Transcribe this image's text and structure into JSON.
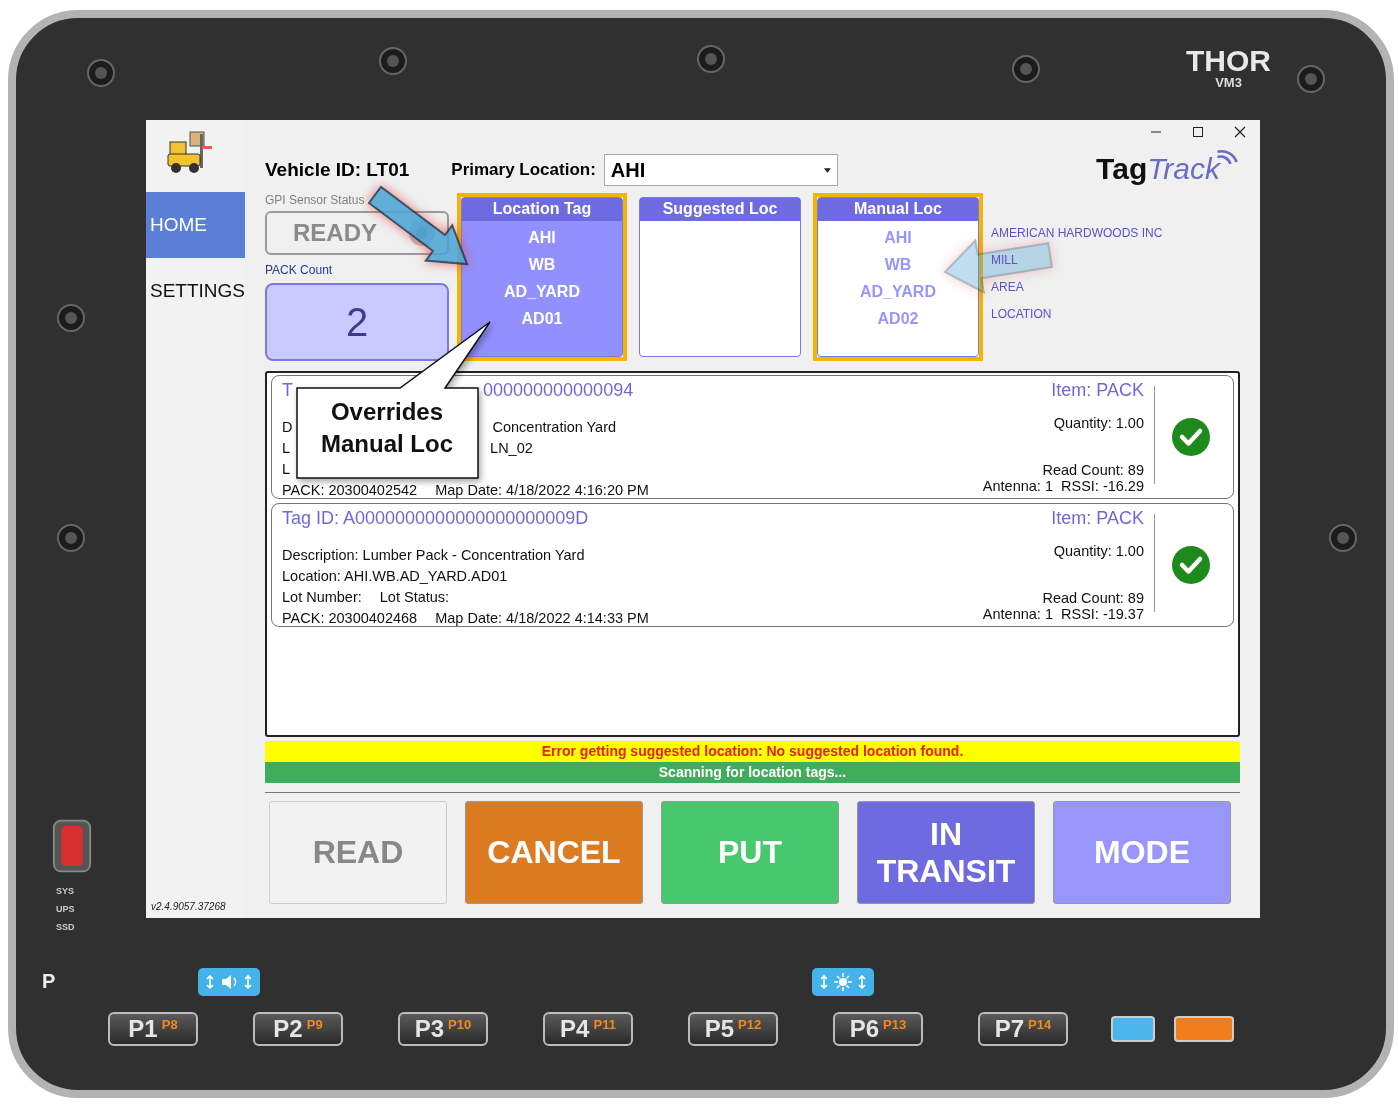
{
  "device": {
    "brand": "THOR",
    "model": "VM3",
    "power_label": "P",
    "indicators": [
      "SYS",
      "UPS",
      "SSD"
    ],
    "hint_icons": [
      {
        "kind": "volume"
      },
      {
        "kind": "brightness"
      }
    ],
    "keys": [
      {
        "label": "P1",
        "alt": "P8"
      },
      {
        "label": "P2",
        "alt": "P9"
      },
      {
        "label": "P3",
        "alt": "P10"
      },
      {
        "label": "P4",
        "alt": "P11"
      },
      {
        "label": "P5",
        "alt": "P12"
      },
      {
        "label": "P6",
        "alt": "P13"
      },
      {
        "label": "P7",
        "alt": "P14"
      }
    ]
  },
  "sidebar": {
    "items": [
      {
        "label": "HOME",
        "selected": true
      },
      {
        "label": "SETTINGS",
        "selected": false
      }
    ],
    "version": "v2.4.9057.37268"
  },
  "header": {
    "vehicle_id": "Vehicle ID: LT01",
    "primary_location_label": "Primary Location:",
    "primary_location": "AHI",
    "logo": {
      "part1": "Tag",
      "part2": "Track"
    }
  },
  "gpi": {
    "label": "GPI Sensor Status",
    "status": "READY",
    "disabled": true
  },
  "pack_count": {
    "label": "PACK Count",
    "value": "2"
  },
  "location_panels": [
    {
      "title": "Location Tag",
      "kind": "filled",
      "highlighted": true,
      "segments": [
        "AHI",
        "WB",
        "AD_YARD",
        "AD01"
      ]
    },
    {
      "title": "Suggested Loc",
      "kind": "plain",
      "highlighted": false
    },
    {
      "title": "Manual Loc",
      "kind": "plain",
      "highlighted": true,
      "segments": [
        "AHI",
        "WB",
        "AD_YARD",
        "AD02"
      ]
    }
  ],
  "legend": [
    "AMERICAN HARDWOODS INC",
    "MILL",
    "AREA",
    "LOCATION"
  ],
  "tags": [
    {
      "covered": true,
      "title": [
        "T",
        "000000000000094"
      ],
      "item": "Item: PACK",
      "lines": [
        [
          "D",
          "Concentration Yard"
        ],
        [
          "L",
          "LN_02"
        ],
        [
          "L"
        ]
      ],
      "pack": "PACK: 20300402542",
      "map_date": "Map Date: 4/18/2022 4:16:20 PM",
      "quantity": "Quantity: 1.00",
      "read_count": "Read Count: 89",
      "antenna": "Antenna: 1",
      "rssi": "RSSI: -16.29",
      "ok": true
    },
    {
      "covered": false,
      "title": [
        "Tag ID: A0000000000000000000009D"
      ],
      "item": "Item: PACK",
      "lines": [
        [
          "Description: Lumber Pack - Concentration Yard"
        ],
        [
          "Location: AHI.WB.AD_YARD.AD01"
        ],
        [
          "Lot Number:",
          "Lot Status:"
        ]
      ],
      "pack": "PACK: 20300402468",
      "map_date": "Map Date: 4/18/2022 4:14:33 PM",
      "quantity": "Quantity: 1.00",
      "read_count": "Read Count: 89",
      "antenna": "Antenna: 1",
      "rssi": "RSSI: -19.37",
      "ok": true
    }
  ],
  "error_message": "Error getting suggested location: No suggested location found.",
  "status_message": "Scanning for location tags...",
  "buttons": [
    {
      "label": "READ",
      "color": "#f2f2f2",
      "disabled": true
    },
    {
      "label": "CANCEL",
      "color": "#dd7b22",
      "disabled": false
    },
    {
      "label": "PUT",
      "color": "#48c86e",
      "disabled": false
    },
    {
      "label": "IN TRANSIT",
      "color": "#6e6adf",
      "disabled": false
    },
    {
      "label": "MODE",
      "color": "#9896fd",
      "disabled": false
    }
  ],
  "callout": "Overrides Manual Loc"
}
